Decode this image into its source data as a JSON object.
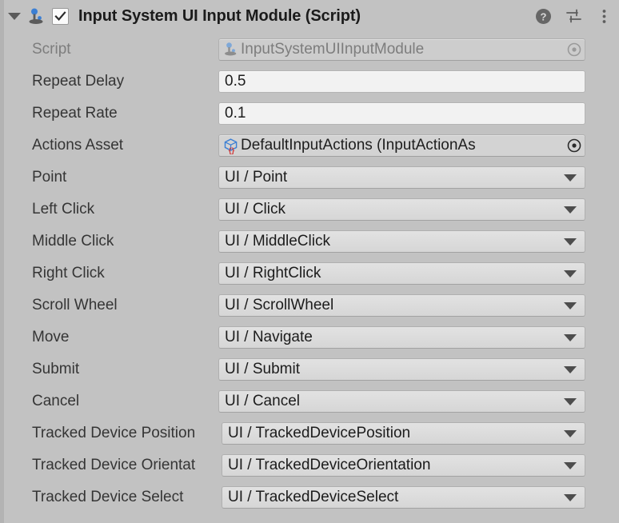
{
  "header": {
    "title": "Input System UI Input Module (Script)",
    "foldout_icon": "triangle-down-icon",
    "component_icon": "joystick-icon",
    "enabled": true,
    "checkbox_glyph": "checkmark",
    "actions": [
      {
        "name": "help-icon",
        "label": "?"
      },
      {
        "name": "preset-icon",
        "label": ""
      },
      {
        "name": "more-menu-icon",
        "label": ""
      }
    ]
  },
  "fields": [
    {
      "label": "Script",
      "type": "object",
      "value": "InputSystemUIInputModule",
      "icon": "joystick-icon",
      "disabled": true,
      "picker": "object-picker-icon"
    },
    {
      "label": "Repeat Delay",
      "type": "number",
      "value": "0.5"
    },
    {
      "label": "Repeat Rate",
      "type": "number",
      "value": "0.1"
    },
    {
      "label": "Actions Asset",
      "type": "object",
      "value": "DefaultInputActions (InputActionAs",
      "icon": "input-actions-asset-icon",
      "disabled": false,
      "picker": "object-picker-icon"
    },
    {
      "label": "Point",
      "type": "dropdown",
      "value": "UI / Point"
    },
    {
      "label": "Left Click",
      "type": "dropdown",
      "value": "UI / Click"
    },
    {
      "label": "Middle Click",
      "type": "dropdown",
      "value": "UI / MiddleClick"
    },
    {
      "label": "Right Click",
      "type": "dropdown",
      "value": "UI / RightClick"
    },
    {
      "label": "Scroll Wheel",
      "type": "dropdown",
      "value": "UI / ScrollWheel"
    },
    {
      "label": "Move",
      "type": "dropdown",
      "value": "UI / Navigate"
    },
    {
      "label": "Submit",
      "type": "dropdown",
      "value": "UI / Submit"
    },
    {
      "label": "Cancel",
      "type": "dropdown",
      "value": "UI / Cancel"
    },
    {
      "label": "Tracked Device Position",
      "type": "dropdown",
      "value": "UI / TrackedDevicePosition",
      "wide_label": true
    },
    {
      "label": "Tracked Device Orientat",
      "type": "dropdown",
      "value": "UI / TrackedDeviceOrientation",
      "wide_label": true
    },
    {
      "label": "Tracked Device Select",
      "type": "dropdown",
      "value": "UI / TrackedDeviceSelect",
      "wide_label": true
    }
  ],
  "colors": {
    "background": "#c2c2c2",
    "label_text": "#353535",
    "label_disabled": "#7d7d7d",
    "field_text": "#1c1c1c",
    "accent_blue": "#3b7fd4",
    "accent_red": "#d03c3c"
  }
}
